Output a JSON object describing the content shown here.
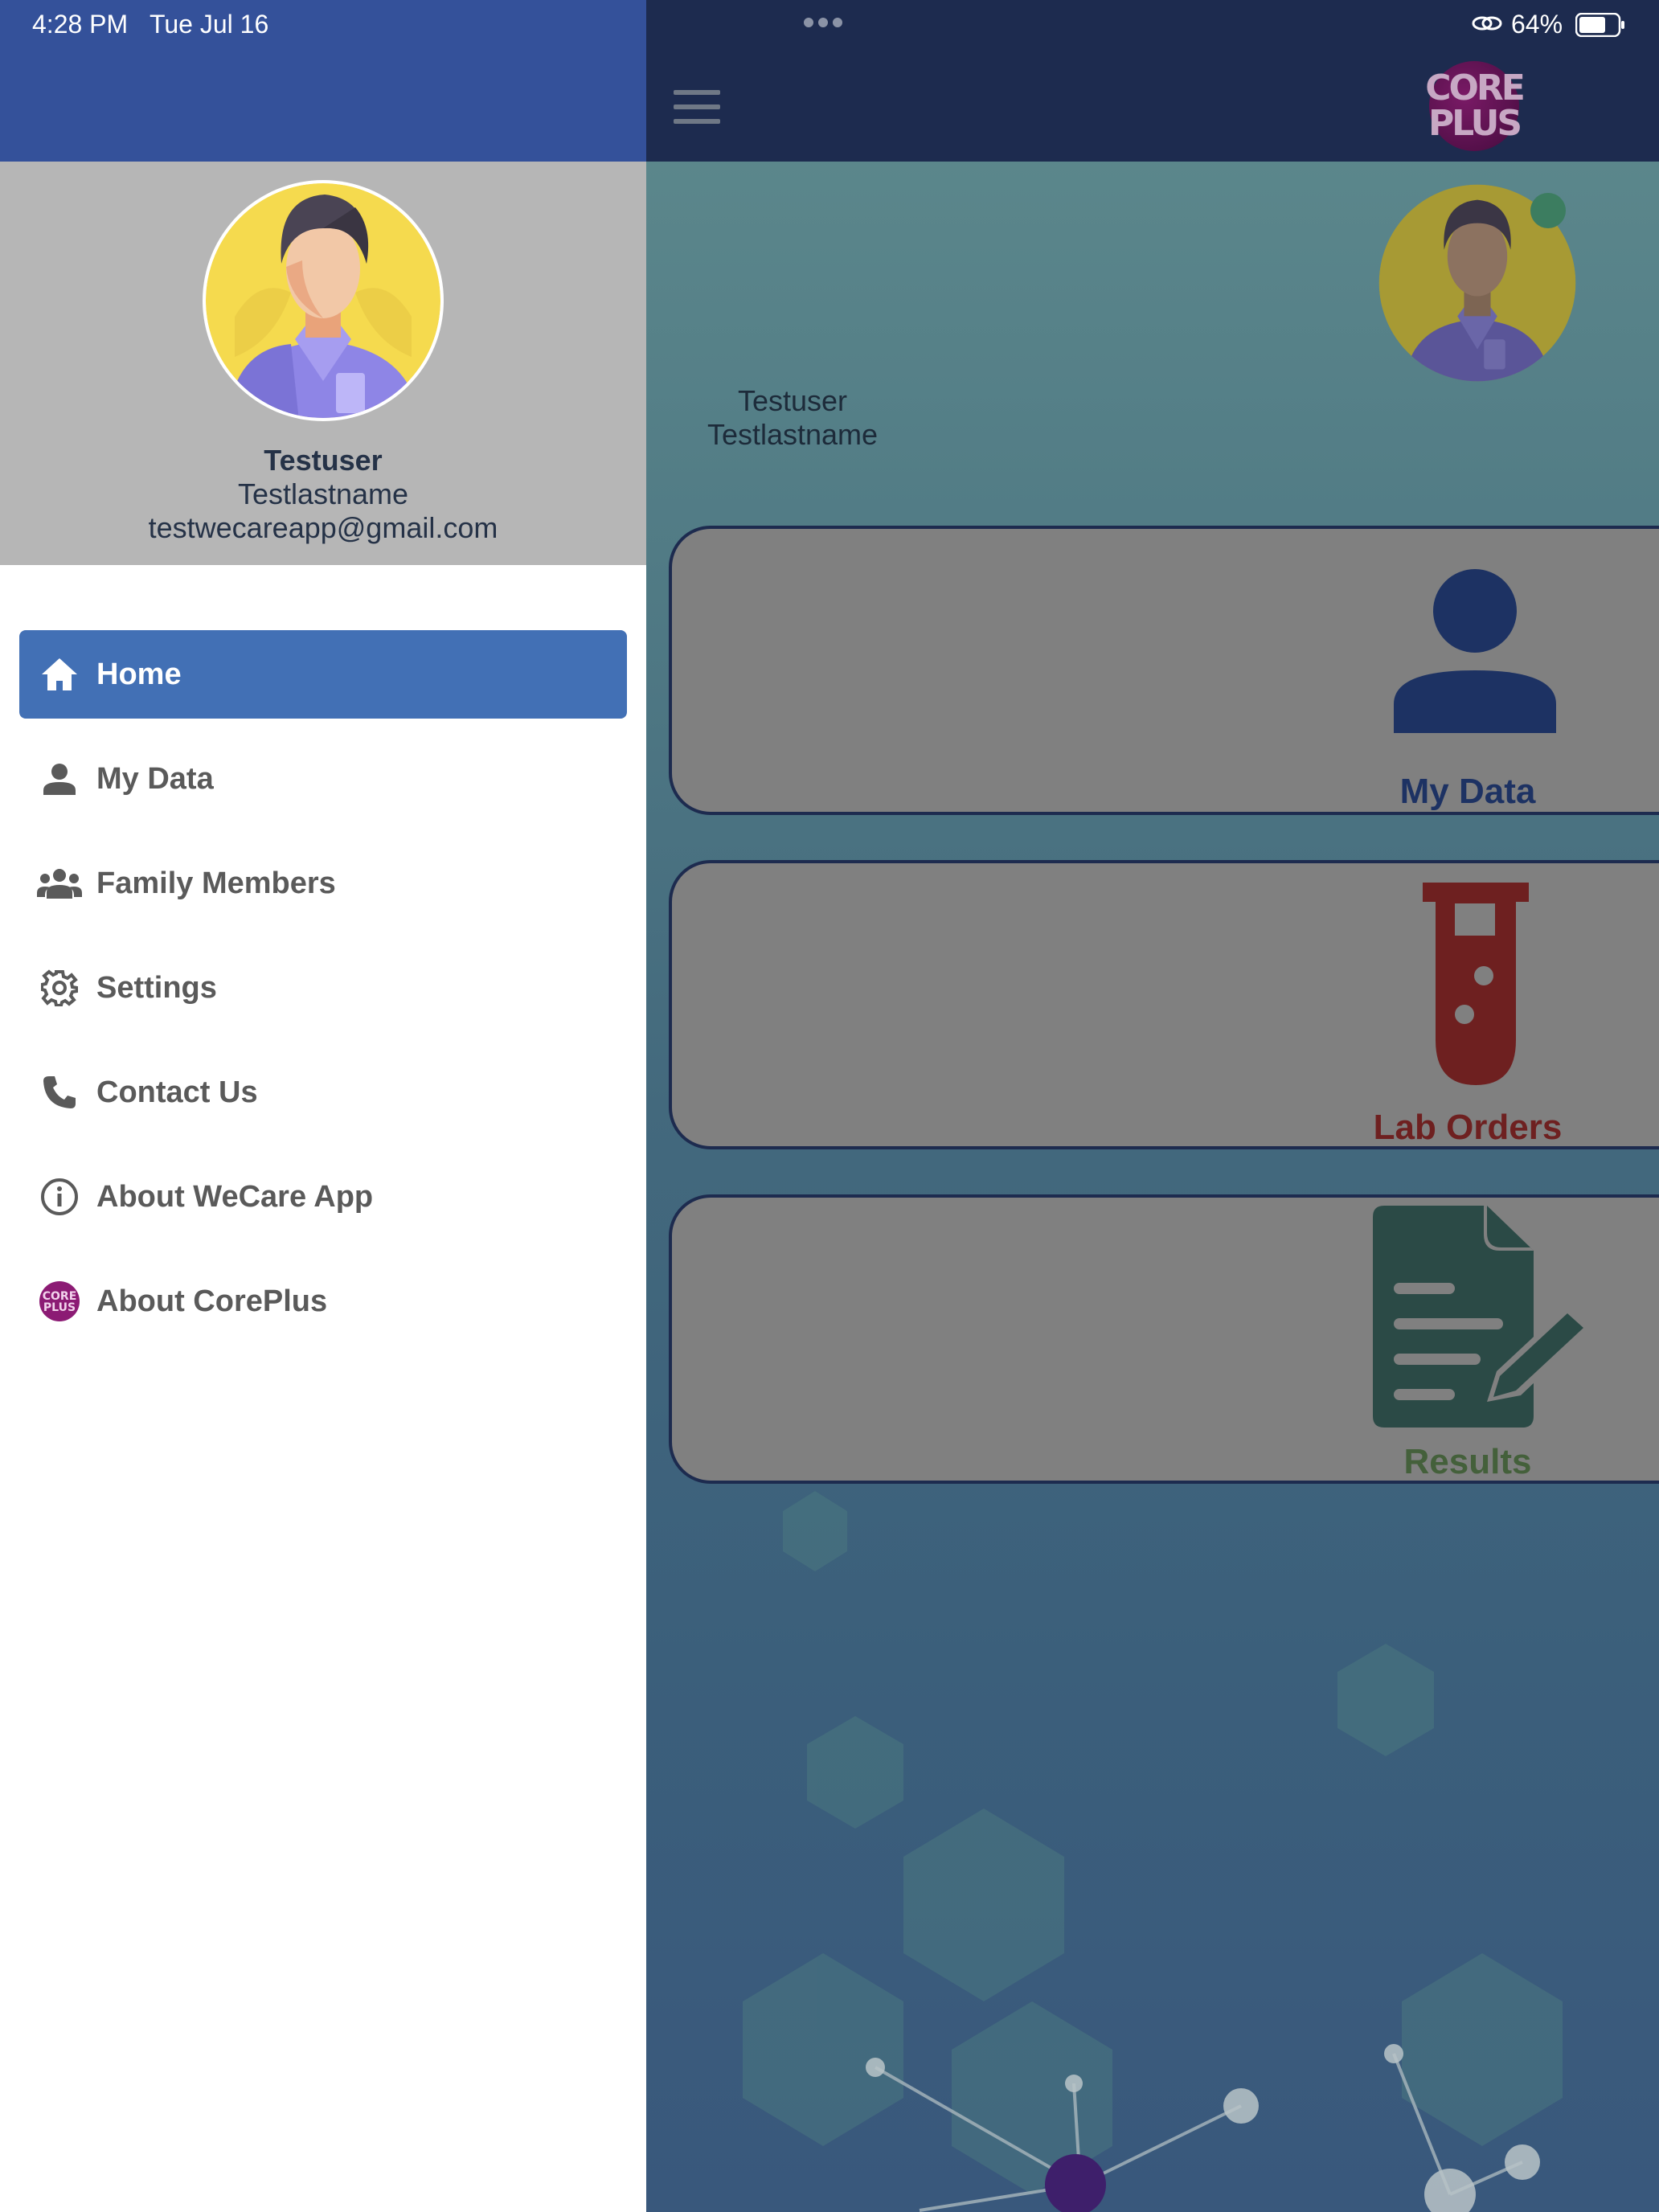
{
  "status_bar": {
    "time": "4:28 PM",
    "date": "Tue Jul 16",
    "battery": "64%"
  },
  "drawer": {
    "user": {
      "first_name": "Testuser",
      "last_name": "Testlastname",
      "email": "testwecareapp@gmail.com"
    },
    "items": [
      {
        "label": "Home",
        "icon": "home-icon",
        "active": true
      },
      {
        "label": "My Data",
        "icon": "person-icon",
        "active": false
      },
      {
        "label": "Family Members",
        "icon": "group-icon",
        "active": false
      },
      {
        "label": "Settings",
        "icon": "gear-icon",
        "active": false
      },
      {
        "label": "Contact Us",
        "icon": "phone-icon",
        "active": false
      },
      {
        "label": "About WeCare App",
        "icon": "info-icon",
        "active": false
      },
      {
        "label": "About CorePlus",
        "icon": "coreplus-logo-icon",
        "active": false
      }
    ]
  },
  "main": {
    "logo_text": [
      "CORE",
      "PLUS"
    ],
    "user": {
      "first_name": "Testuser",
      "last_name": "Testlastname"
    },
    "cards": [
      {
        "label": "My Data",
        "icon": "person-icon",
        "color": "#1d3263"
      },
      {
        "label": "Lab Orders",
        "icon": "test-tube-icon",
        "color": "#6e2020"
      },
      {
        "label": "Results",
        "icon": "document-edit-icon",
        "color": "#44603b"
      }
    ]
  },
  "colors": {
    "drawer_header_bar": "#34519a",
    "active_item": "#4270b5",
    "main_top_bar": "#1d2b4f"
  }
}
